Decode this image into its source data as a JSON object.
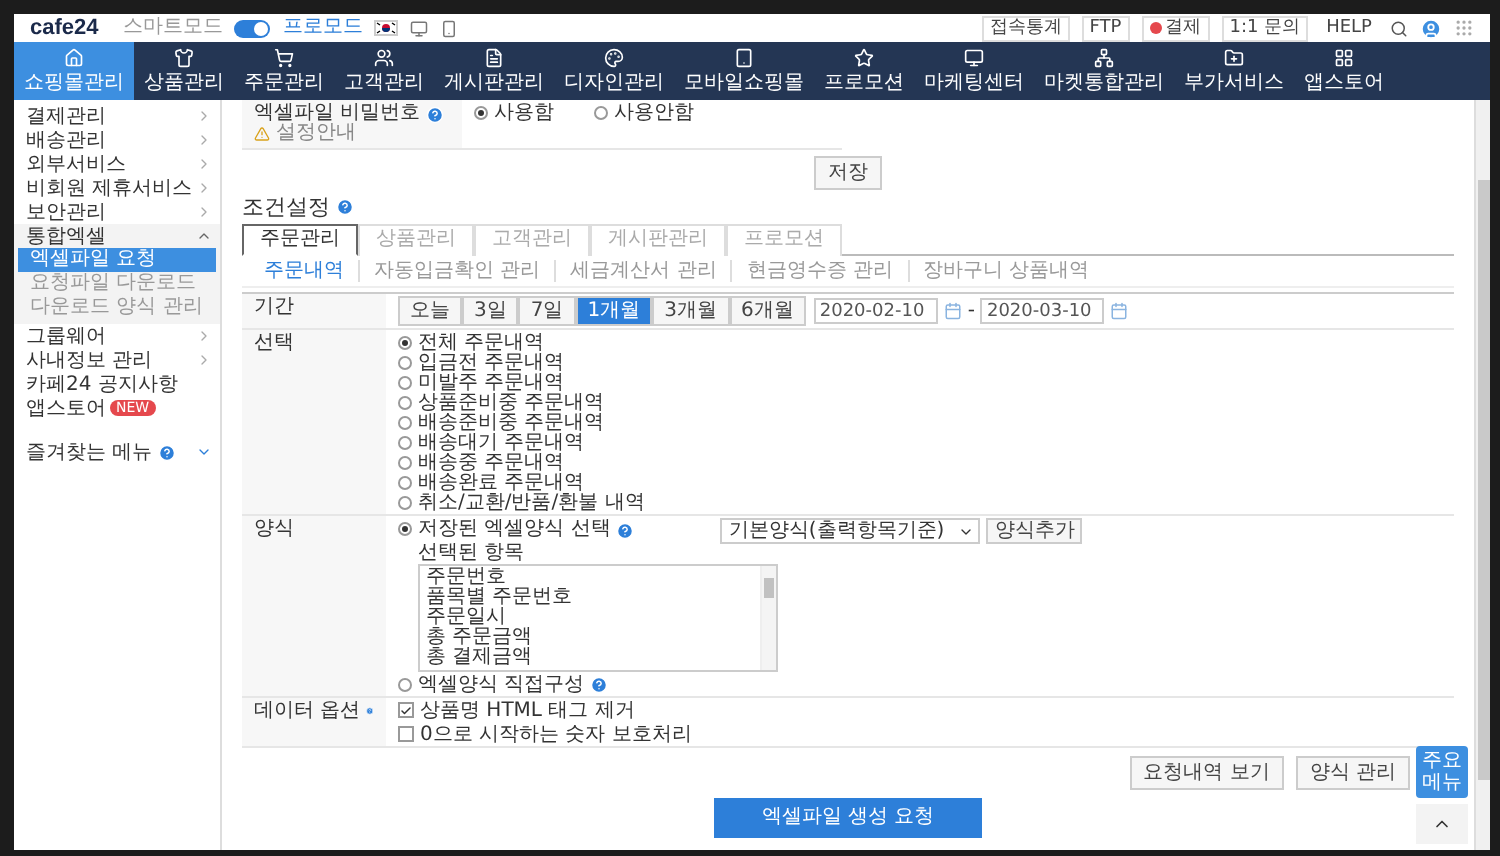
{
  "top_bar": {
    "logo": "cafe24",
    "mode_toggle": {
      "left_label": "스마트모드",
      "right_label": "프로모드",
      "on": true
    },
    "links": [
      "접속통계",
      "FTP",
      "결제",
      "1:1 문의"
    ],
    "help": "HELP"
  },
  "nav": [
    {
      "label": "쇼핑몰관리",
      "selected": true
    },
    {
      "label": "상품관리",
      "selected": false
    },
    {
      "label": "주문관리",
      "selected": false
    },
    {
      "label": "고객관리",
      "selected": false
    },
    {
      "label": "게시판관리",
      "selected": false
    },
    {
      "label": "디자인관리",
      "selected": false
    },
    {
      "label": "모바일쇼핑몰",
      "selected": false
    },
    {
      "label": "프로모션",
      "selected": false
    },
    {
      "label": "마케팅센터",
      "selected": false
    },
    {
      "label": "마켓통합관리",
      "selected": false
    },
    {
      "label": "부가서비스",
      "selected": false
    },
    {
      "label": "앱스토어",
      "selected": false
    }
  ],
  "sidebar": {
    "items": [
      {
        "label": "결제관리",
        "kind": "folder",
        "expanded": false
      },
      {
        "label": "배송관리",
        "kind": "folder",
        "expanded": false
      },
      {
        "label": "외부서비스",
        "kind": "folder",
        "expanded": false
      },
      {
        "label": "비회원 제휴서비스",
        "kind": "folder",
        "expanded": false
      },
      {
        "label": "보안관리",
        "kind": "folder",
        "expanded": false
      },
      {
        "label": "통합엑셀",
        "kind": "folder",
        "expanded": true,
        "children": [
          {
            "label": "엑셀파일 요청",
            "selected": true
          },
          {
            "label": "요청파일 다운로드",
            "selected": false
          },
          {
            "label": "다운로드 양식 관리",
            "selected": false
          }
        ]
      },
      {
        "label": "그룹웨어",
        "kind": "folder",
        "expanded": false
      },
      {
        "label": "사내정보 관리",
        "kind": "folder",
        "expanded": false
      },
      {
        "label": "카페24 공지사항",
        "kind": "link"
      },
      {
        "label": "앱스토어",
        "kind": "link",
        "badge": "NEW"
      }
    ],
    "favorites": {
      "label": "즐겨찾는 메뉴"
    }
  },
  "password_setting": {
    "label": "엑셀파일 비밀번호",
    "note": "설정안내",
    "options": [
      {
        "label": "사용함",
        "selected": true
      },
      {
        "label": "사용안함",
        "selected": false
      }
    ]
  },
  "save_button": "저장",
  "condition": {
    "title": "조건설정",
    "tabs": [
      {
        "label": "주문관리",
        "selected": true
      },
      {
        "label": "상품관리",
        "selected": false
      },
      {
        "label": "고객관리",
        "selected": false
      },
      {
        "label": "게시판관리",
        "selected": false
      },
      {
        "label": "프로모션",
        "selected": false
      }
    ],
    "subtabs": [
      {
        "label": "주문내역",
        "selected": true
      },
      {
        "label": "자동입금확인 관리",
        "selected": false
      },
      {
        "label": "세금계산서 관리",
        "selected": false
      },
      {
        "label": "현금영수증 관리",
        "selected": false
      },
      {
        "label": "장바구니 상품내역",
        "selected": false
      }
    ],
    "period": {
      "label": "기간",
      "buttons": [
        {
          "label": "오늘",
          "selected": false
        },
        {
          "label": "3일",
          "selected": false
        },
        {
          "label": "7일",
          "selected": false
        },
        {
          "label": "1개월",
          "selected": true
        },
        {
          "label": "3개월",
          "selected": false
        },
        {
          "label": "6개월",
          "selected": false
        }
      ],
      "start": "2020-02-10",
      "separator": "-",
      "end": "2020-03-10"
    },
    "selection": {
      "label": "선택",
      "options": [
        {
          "label": "전체 주문내역",
          "selected": true
        },
        {
          "label": "입금전 주문내역",
          "selected": false
        },
        {
          "label": "미발주 주문내역",
          "selected": false
        },
        {
          "label": "상품준비중 주문내역",
          "selected": false
        },
        {
          "label": "배송준비중 주문내역",
          "selected": false
        },
        {
          "label": "배송대기 주문내역",
          "selected": false
        },
        {
          "label": "배송중 주문내역",
          "selected": false
        },
        {
          "label": "배송완료 주문내역",
          "selected": false
        },
        {
          "label": "취소/교환/반품/환불 내역",
          "selected": false
        }
      ]
    },
    "format": {
      "label": "양식",
      "options": [
        {
          "label": "저장된 엑셀양식 선택",
          "selected": true
        },
        {
          "label": "엑셀양식 직접구성",
          "selected": false
        }
      ],
      "template": "기본양식(출력항목기준)",
      "add_button": "양식추가",
      "selected_label": "선택된 항목",
      "fields": [
        "주문번호",
        "품목별 주문번호",
        "주문일시",
        "총 주문금액",
        "총 결제금액"
      ]
    },
    "data_options": {
      "label": "데이터 옵션",
      "checks": [
        {
          "label": "상품명 HTML 태그 제거",
          "checked": true
        },
        {
          "label": "0으로 시작하는 숫자 보호처리",
          "checked": false
        }
      ]
    }
  },
  "actions": [
    "요청내역 보기",
    "양식 관리"
  ],
  "submit": "엑셀파일 생성 요청",
  "floating_menu": "주요 메뉴"
}
